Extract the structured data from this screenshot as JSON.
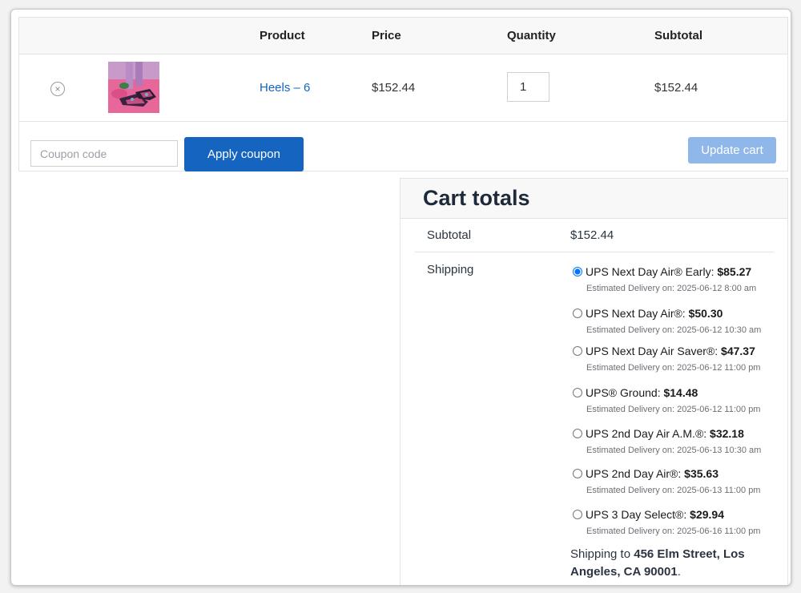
{
  "cart": {
    "headers": {
      "product": "Product",
      "price": "Price",
      "quantity": "Quantity",
      "subtotal": "Subtotal"
    },
    "row": {
      "remove_icon": "×",
      "product_name": "Heels – 6",
      "price": "$152.44",
      "quantity": "1",
      "subtotal": "$152.44"
    },
    "coupon_placeholder": "Coupon code",
    "apply_label": "Apply coupon",
    "update_label": "Update cart"
  },
  "totals": {
    "title": "Cart totals",
    "subtotal_label": "Subtotal",
    "subtotal_value": "$152.44",
    "shipping_label": "Shipping",
    "options": [
      {
        "label": "UPS Next Day Air® Early: ",
        "price": "$85.27",
        "estimate": "Estimated Delivery on: 2025-06-12 8:00 am",
        "selected": true
      },
      {
        "label": "UPS Next Day Air®: ",
        "price": "$50.30",
        "estimate": "Estimated Delivery on: 2025-06-12 10:30  am",
        "selected": false
      },
      {
        "label": "UPS Next Day Air Saver®: ",
        "price": "$47.37",
        "estimate": "Estimated Delivery on: 2025-06-12 11:00 pm",
        "selected": false
      },
      {
        "label": "UPS® Ground: ",
        "price": "$14.48",
        "estimate": "Estimated Delivery on: 2025-06-12 11:00 pm",
        "selected": false
      },
      {
        "label": "UPS 2nd Day Air A.M.®: ",
        "price": "$32.18",
        "estimate": "Estimated Delivery on: 2025-06-13 10:30  am",
        "selected": false
      },
      {
        "label": "UPS 2nd Day Air®: ",
        "price": "$35.63",
        "estimate": "Estimated Delivery on: 2025-06-13 11:00 pm",
        "selected": false
      },
      {
        "label": "UPS 3 Day Select®: ",
        "price": "$29.94",
        "estimate": "Estimated Delivery on: 2025-06-16 11:00 pm",
        "selected": false
      }
    ],
    "ship_to_prefix": "Shipping to ",
    "ship_to_address": "456 Elm Street, Los Angeles, CA 90001",
    "ship_to_suffix": "."
  },
  "colors": {
    "accent": "#1565c0",
    "accent_disabled": "#8fb7ea",
    "header_bg": "#f8f8f8"
  }
}
